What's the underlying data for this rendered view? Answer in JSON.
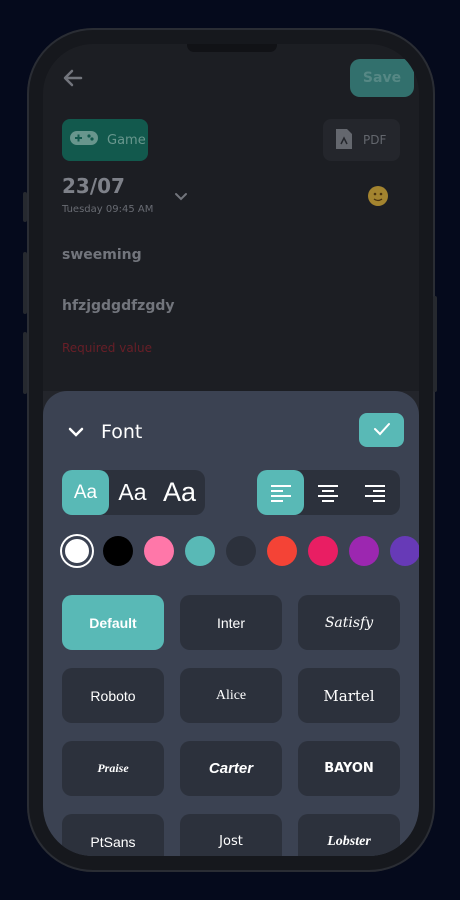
{
  "header": {
    "save_label": "Save"
  },
  "category": {
    "label": "Game",
    "pdf_label": "PDF"
  },
  "note": {
    "date": "23/07",
    "datetime": "Tuesday 09:45 AM",
    "title": "sweeming",
    "body": "hfzjgdgdfzgdy",
    "error": "Required value"
  },
  "font_panel": {
    "title": "Font",
    "size_options": [
      "Aa",
      "Aa",
      "Aa"
    ],
    "selected_size": 0,
    "selected_align": 0,
    "colors": [
      "#ffffff",
      "#000000",
      "#ff77a9",
      "#59b9b6",
      "#2c313c",
      "#f44336",
      "#e91e63",
      "#9c27b0",
      "#673ab7"
    ],
    "selected_color": 0,
    "fonts": [
      "Default",
      "Inter",
      "Satisfy",
      "Roboto",
      "Alice",
      "Martel",
      "Praise",
      "Carter",
      "BAYON",
      "PtSans",
      "Jost",
      "Lobster"
    ],
    "selected_font": 0
  },
  "accent": "#59b9b6"
}
